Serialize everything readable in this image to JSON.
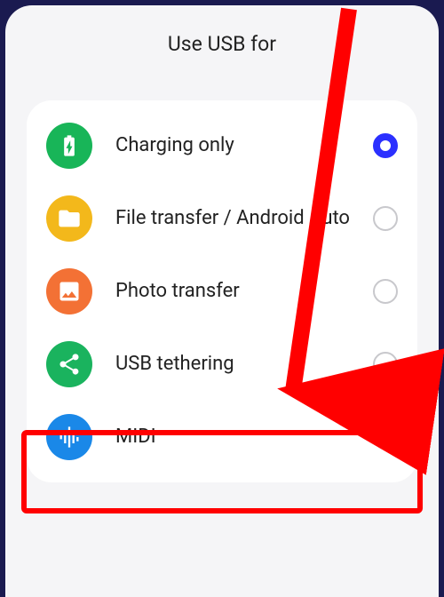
{
  "title": "Use USB for",
  "options": [
    {
      "id": "charging",
      "label": "Charging only",
      "selected": true
    },
    {
      "id": "filetransfer",
      "label": "File transfer / Android Auto",
      "selected": false
    },
    {
      "id": "photo",
      "label": "Photo transfer",
      "selected": false
    },
    {
      "id": "tether",
      "label": "USB tethering",
      "selected": false
    },
    {
      "id": "midi",
      "label": "MIDI",
      "selected": false
    }
  ],
  "annotation": {
    "highlight_option_id": "tether",
    "arrow": true
  }
}
